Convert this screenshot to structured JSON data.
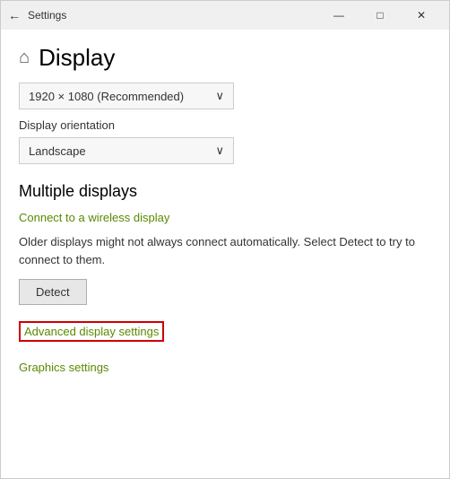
{
  "window": {
    "title": "Settings",
    "back_icon": "←",
    "minimize_icon": "—",
    "maximize_icon": "□",
    "close_icon": "✕"
  },
  "page": {
    "home_icon": "⌂",
    "title": "Display"
  },
  "resolution": {
    "label": "",
    "value": "1920 × 1080 (Recommended)",
    "chevron": "∨"
  },
  "orientation": {
    "label": "Display orientation",
    "value": "Landscape",
    "chevron": "∨"
  },
  "multiple_displays": {
    "section_title": "Multiple displays",
    "wireless_link": "Connect to a wireless display",
    "description": "Older displays might not always connect automatically. Select Detect to try to connect to them.",
    "detect_button": "Detect",
    "advanced_link": "Advanced display settings",
    "graphics_link": "Graphics settings"
  }
}
